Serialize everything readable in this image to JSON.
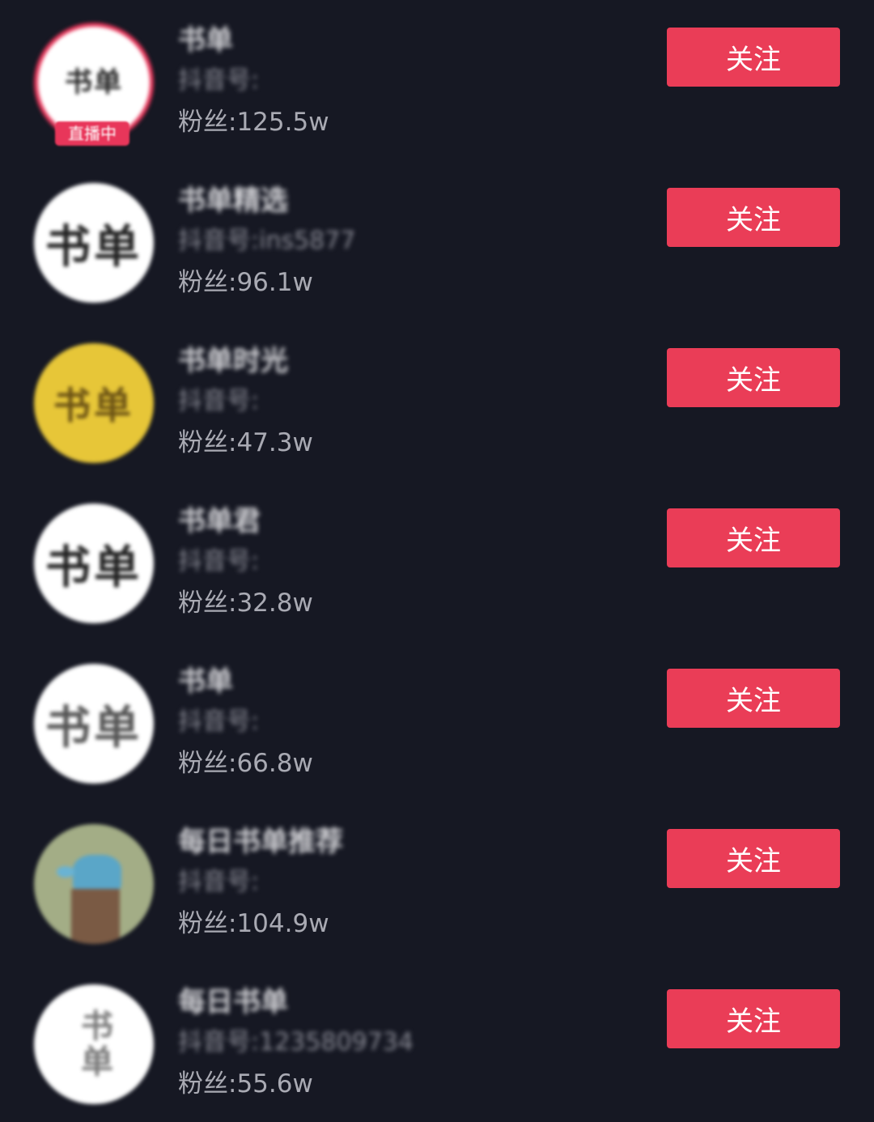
{
  "users": [
    {
      "nickname": "书单",
      "douyin_id": "抖音号:",
      "fans": "粉丝:125.5w",
      "follow_label": "关注",
      "live_badge": "直播中",
      "avatar_text": "书单"
    },
    {
      "nickname": "书单精选",
      "douyin_id": "抖音号:ins5877",
      "fans": "粉丝:96.1w",
      "follow_label": "关注",
      "avatar_text": "书单"
    },
    {
      "nickname": "书单时光",
      "douyin_id": "抖音号:",
      "fans": "粉丝:47.3w",
      "follow_label": "关注",
      "avatar_text": "书单"
    },
    {
      "nickname": "书单君",
      "douyin_id": "抖音号:",
      "fans": "粉丝:32.8w",
      "follow_label": "关注",
      "avatar_text": "书单"
    },
    {
      "nickname": "书单",
      "douyin_id": "抖音号:",
      "fans": "粉丝:66.8w",
      "follow_label": "关注",
      "avatar_text": "书单"
    },
    {
      "nickname": "每日书单推荐",
      "douyin_id": "抖音号:",
      "fans": "粉丝:104.9w",
      "follow_label": "关注"
    },
    {
      "nickname": "每日书单",
      "douyin_id": "抖音号:1235809734",
      "fans": "粉丝:55.6w",
      "follow_label": "关注",
      "avatar_text": "书单"
    }
  ],
  "colors": {
    "background": "#161823",
    "follow_button": "#ea3d57",
    "live_ring": "#e8365a"
  }
}
